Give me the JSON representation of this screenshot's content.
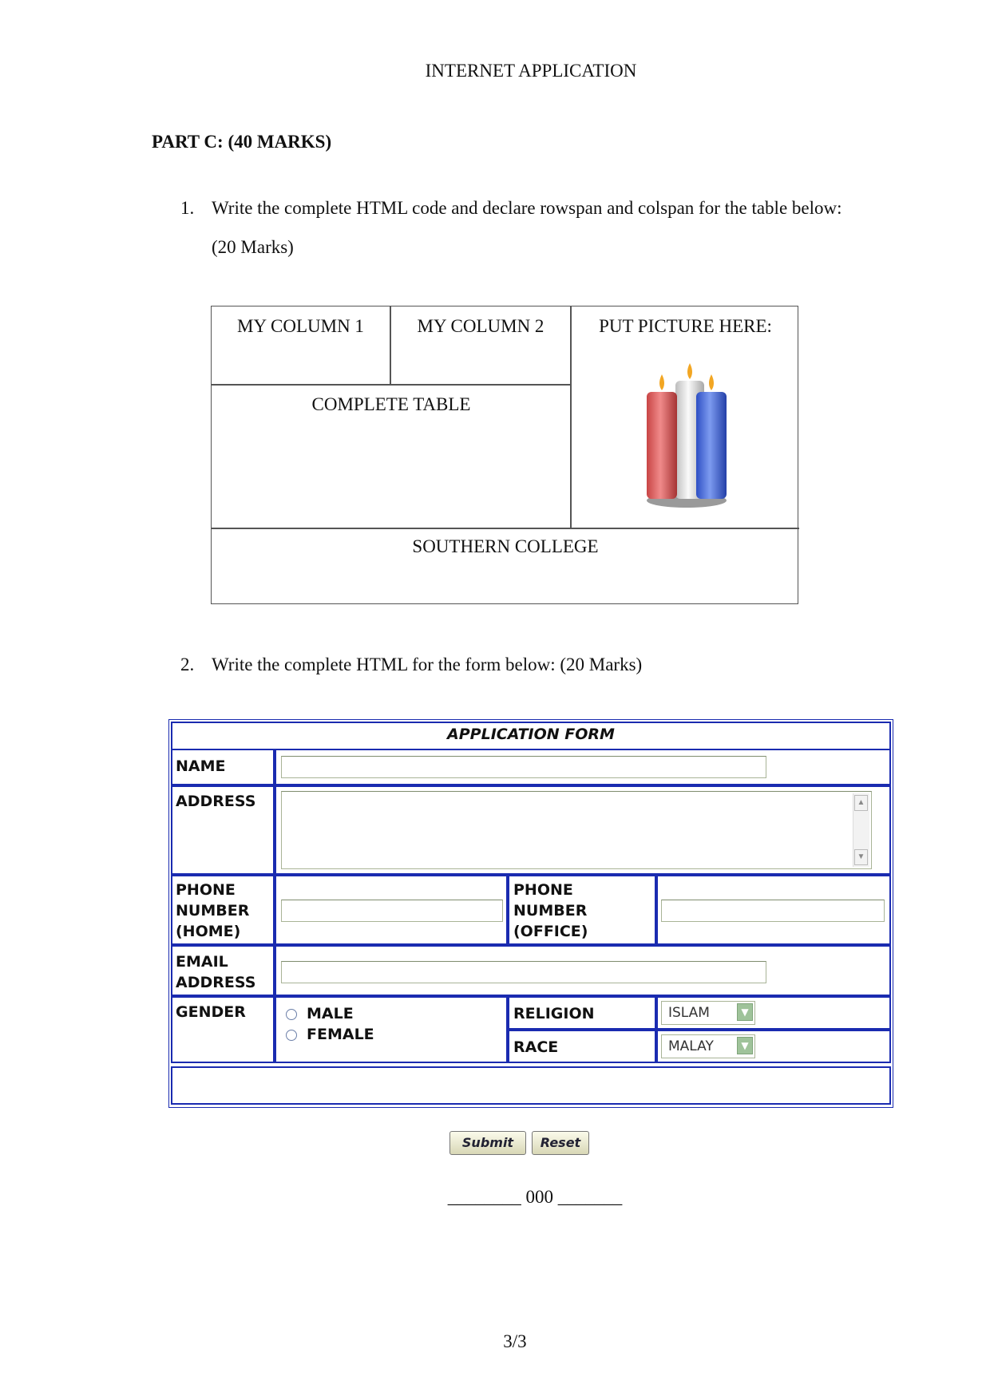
{
  "document": {
    "title": "INTERNET APPLICATION",
    "part_heading": "PART C: (40 MARKS)",
    "footer_code": "________ 000 _______",
    "page_number": "3/3"
  },
  "question1": {
    "number": "1.",
    "text": "Write the complete HTML code and declare rowspan and colspan for the table below:",
    "marks": "(20 Marks)",
    "table": {
      "col1": "MY COLUMN 1",
      "col2": "MY COLUMN 2",
      "picture_cell": "PUT PICTURE HERE:",
      "merged_row": "COMPLETE TABLE",
      "footer_row": "SOUTHERN COLLEGE",
      "picture_icon": "candles-icon"
    }
  },
  "question2": {
    "number": "2.",
    "text": "Write the complete HTML for the form below: (20 Marks)",
    "form": {
      "title": "APPLICATION FORM",
      "name_label": "NAME",
      "address_label": "ADDRESS",
      "phone_home_label": [
        "PHONE",
        "NUMBER",
        "(HOME)"
      ],
      "phone_office_label": [
        "PHONE",
        "NUMBER",
        "(OFFICE)"
      ],
      "email_label": [
        "EMAIL",
        "ADDRESS"
      ],
      "gender_label": "GENDER",
      "gender_options": [
        "MALE",
        "FEMALE"
      ],
      "religion_label": "RELIGION",
      "religion_value": "ISLAM",
      "race_label": "RACE",
      "race_value": "MALAY",
      "submit_label": "Submit",
      "reset_label": "Reset",
      "accent_color": "#1a2bb0"
    }
  }
}
